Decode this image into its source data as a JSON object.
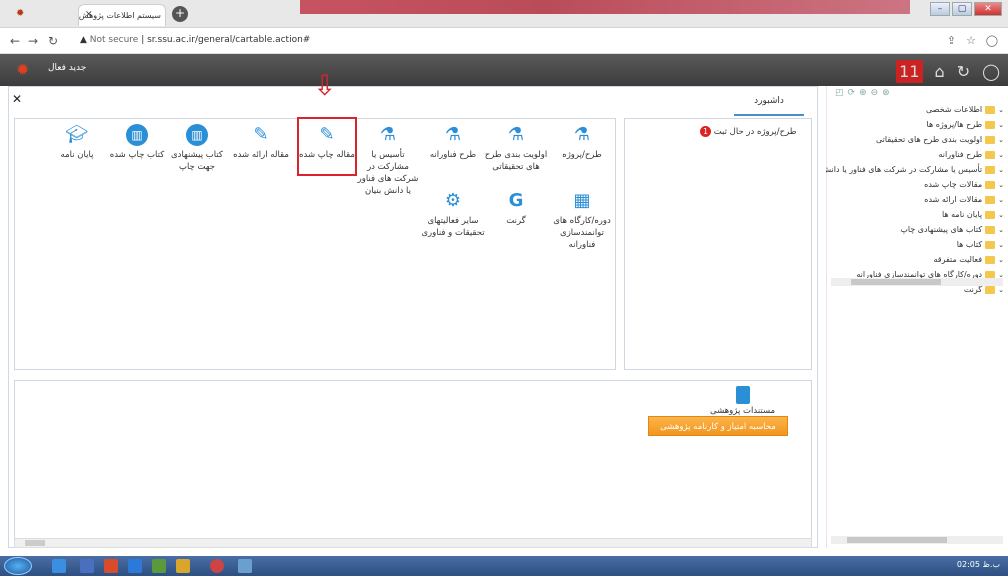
{
  "browser": {
    "tab_title": "سیستم اطلاعات پژوهش",
    "url_security": "Not secure",
    "url": "sr.ssu.ac.ir/general/cartable.action#"
  },
  "app": {
    "header_title": "جدید فعال",
    "notif_count": "11"
  },
  "dashboard": {
    "tab_label": "داشبورد",
    "in_progress_label": "طرح/پروژه در حال ثبت",
    "in_progress_count": "1",
    "items_row1": [
      {
        "label": "طرح/پروژه",
        "icon": "microscope-icon"
      },
      {
        "label": "اولویت بندی طرح های تحقیقاتی",
        "icon": "microscope-icon"
      },
      {
        "label": "طرح فناورانه",
        "icon": "microscope-icon"
      },
      {
        "label": "تأسیس یا مشارکت در شرکت های فناور یا دانش بنیان",
        "icon": "microscope-icon"
      },
      {
        "label": "مقاله چاپ شده",
        "icon": "edit-doc-icon"
      },
      {
        "label": "مقاله ارائه شده",
        "icon": "edit-doc-icon"
      },
      {
        "label": "کتاب پیشنهادی جهت چاپ",
        "icon": "book-icon"
      },
      {
        "label": "کتاب چاپ شده",
        "icon": "book-icon"
      },
      {
        "label": "پایان نامه",
        "icon": "graduation-cap-icon"
      }
    ],
    "items_row2": [
      {
        "label": "دوره/کارگاه های توانمندسازی فناورانه",
        "icon": "presentation-icon"
      },
      {
        "label": "گرنت",
        "icon": "grant-g-icon"
      },
      {
        "label": "سایر فعالیتهای تحقیقات و فناوری",
        "icon": "activities-icon"
      }
    ],
    "docs_label": "مستندات پژوهشی",
    "calc_button": "محاسبه امتیاز و کارنامه پژوهشی"
  },
  "tree": {
    "items": [
      "اطلاعات شخصی",
      "طرح ها/پروژه ها",
      "اولویت بندی طرح های تحقیقاتی",
      "طرح فناورانه",
      "تأسیس یا مشارکت در شرکت های فناور یا دانش بنیان",
      "مقالات چاپ شده",
      "مقالات ارائه شده",
      "پایان نامه ها",
      "کتاب های پیشنهادی چاپ",
      "کتاب ها",
      "فعالیت متفرقه",
      "دوره/کارگاه های توانمندسازی فناورانه",
      "گرنت"
    ]
  },
  "taskbar": {
    "clock": "02:05 ب.ظ"
  }
}
